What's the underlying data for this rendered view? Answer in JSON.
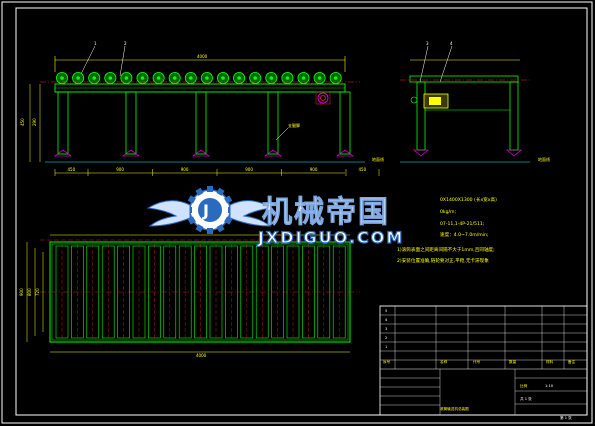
{
  "watermark": {
    "brand_cn": "机械帝国",
    "brand_en": "JXDIGUO.COM",
    "logo": "gear-wings-logo"
  },
  "front_view": {
    "part_labels": [
      "1",
      "2"
    ],
    "overall_length": "4000",
    "height_dims": [
      "450",
      "290"
    ],
    "bottom_dims": [
      "450",
      "900",
      "900",
      "900",
      "900",
      "450"
    ],
    "leg_label": "支腿脚",
    "ground_label": "地面线"
  },
  "side_view": {
    "part_labels": [
      "3",
      "4"
    ],
    "ground_label": "地面线"
  },
  "plan_view": {
    "overall_length": "4000",
    "width_dims": [
      "720",
      "800",
      "900"
    ]
  },
  "notes": {
    "line1": "0X1400X1300 (长x宽x高)",
    "line2": "0kg/m;",
    "line3": "07-11,1-4P-21/511;",
    "line4": "速度：4.0~7.0m/min;",
    "line5": "1)滚筒表面之间距离间隔不大于1mm,且同轴度;",
    "line6": "2)安装位置准确,链轮要对正,平稳,无卡滞现象"
  },
  "title_block": {
    "rows": [
      {
        "idx": "5",
        "name": "",
        "code": "",
        "qty": "",
        "mat": "",
        "note": ""
      },
      {
        "idx": "4",
        "name": "",
        "code": "",
        "qty": "",
        "mat": "",
        "note": ""
      },
      {
        "idx": "3",
        "name": "",
        "code": "",
        "qty": "",
        "mat": "",
        "note": ""
      },
      {
        "idx": "2",
        "name": "",
        "code": "",
        "qty": "",
        "mat": "",
        "note": ""
      },
      {
        "idx": "1",
        "name": "",
        "code": "",
        "qty": "",
        "mat": "",
        "note": ""
      }
    ],
    "header": {
      "idx": "序号",
      "name": "名称",
      "code": "代号",
      "qty": "数量",
      "mat": "材料",
      "note": "备注"
    },
    "drawing_title": "滚筒输送机总装图",
    "scale_label": "比例",
    "scale_value": "1:10",
    "sheet_label": "共 1 张",
    "sheet_no": "第 1 张"
  },
  "colors": {
    "background": "#000000",
    "frame": "#ffffff",
    "roller": "#00ff00",
    "centerline": "#ff2020",
    "dimension": "#ffff00",
    "hatch": "#ff00ff",
    "brand_blue": "#2b6bbf"
  }
}
